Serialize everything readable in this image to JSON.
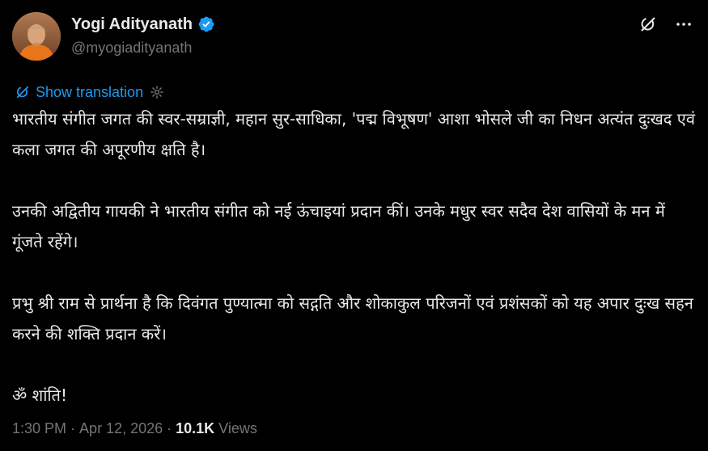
{
  "author": {
    "display_name": "Yogi Adityanath",
    "handle": "@myogiadityanath",
    "verified": true
  },
  "header": {
    "grok_icon": "grok-icon",
    "more_icon": "more-horizontal-icon"
  },
  "translation": {
    "label": "Show translation",
    "link_color": "#1d9bf0"
  },
  "tweet": {
    "paragraphs": [
      "भारतीय संगीत जगत की स्वर-सम्राज्ञी, महान सुर-साधिका, 'पद्म विभूषण' आशा भोसले जी का निधन अत्यंत दुःखद एवं कला जगत की अपूरणीय क्षति है।",
      "उनकी अद्वितीय गायकी ने भारतीय संगीत को नई ऊंचाइयां प्रदान कीं। उनके मधुर स्वर सदैव देश वासियों के मन में गूंजते रहेंगे।",
      "प्रभु श्री राम से प्रार्थना है कि दिवंगत पुण्यात्मा को सद्गति और शोकाकुल परिजनों एवं प्रशंसकों को यह अपार दुःख सहन करने की शक्ति प्रदान करें।",
      "ॐ शांति!"
    ]
  },
  "meta": {
    "time": "1:30 PM",
    "separator": "·",
    "date": "Apr 12, 2026",
    "views_count": "10.1K",
    "views_label": "Views"
  },
  "colors": {
    "background": "#000000",
    "text_primary": "#e7e9ea",
    "text_secondary": "#71767b",
    "accent": "#1d9bf0"
  }
}
